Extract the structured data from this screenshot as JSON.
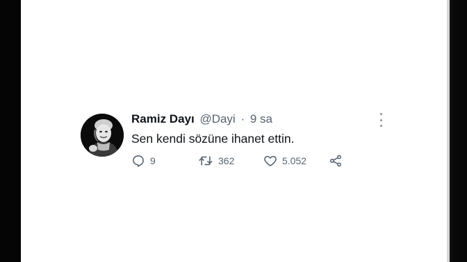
{
  "tweet": {
    "author_name": "Ramiz Dayı",
    "handle": "@Dayi",
    "separator": "·",
    "time": "9 sa",
    "text": "Sen kendi sözüne ihanet ettin.",
    "replies": "9",
    "retweets": "362",
    "likes": "5.052"
  },
  "icons": {
    "reply": "reply-icon",
    "retweet": "retweet-icon",
    "like": "heart-icon",
    "share": "share-icon",
    "more": "more-options-icon"
  },
  "colors": {
    "text_primary": "#0f1419",
    "text_secondary": "#536471"
  }
}
